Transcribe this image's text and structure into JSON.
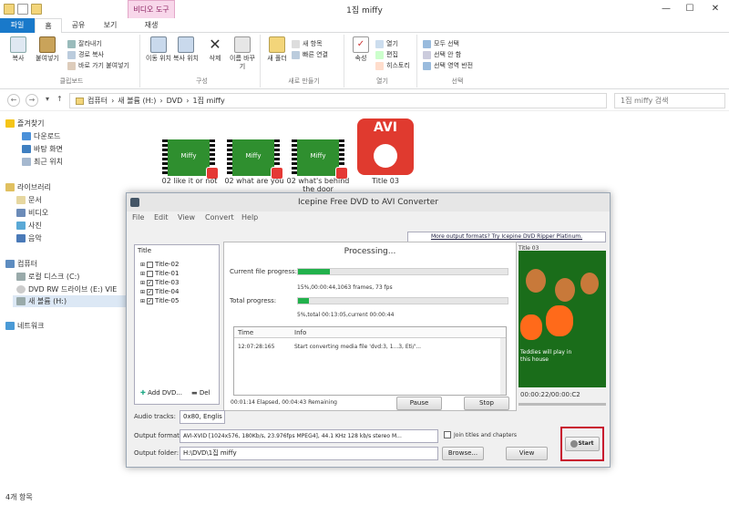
{
  "window": {
    "title": "1집 miffy",
    "context_tab": "비디오 도구",
    "controls": {
      "minimize": "—",
      "maximize": "☐",
      "close": "✕"
    }
  },
  "ribbon_tabs": [
    "파일",
    "홈",
    "공유",
    "보기",
    "재생"
  ],
  "ribbon": {
    "clipboard": {
      "items": [
        "복사",
        "붙여넣기"
      ],
      "small": [
        "잘라내기",
        "경로 복사",
        "바로 가기 붙여넣기"
      ],
      "label": "클립보드"
    },
    "organize": {
      "items": [
        "이동 위치",
        "복사 위치",
        "삭제",
        "이름 바꾸기"
      ],
      "label": "구성"
    },
    "new": {
      "items": [
        "새 폴더"
      ],
      "small": [
        "새 항목",
        "빠른 연결"
      ],
      "label": "새로 만들기"
    },
    "open": {
      "items": [
        "속성"
      ],
      "small": [
        "열기",
        "편집",
        "히스토리"
      ],
      "label": "열기"
    },
    "select": {
      "small": [
        "모두 선택",
        "선택 안 함",
        "선택 영역 반전"
      ],
      "label": "선택"
    }
  },
  "address": {
    "path": [
      "컴퓨터",
      "새 볼륨 (H:)",
      "DVD",
      "1집 miffy"
    ],
    "search_placeholder": "1집 miffy 검색"
  },
  "nav": {
    "favorites": "즐겨찾기",
    "fav_items": [
      "다운로드",
      "바탕 화면",
      "최근 위치"
    ],
    "libraries": "라이브러리",
    "lib_items": [
      "문서",
      "비디오",
      "사진",
      "음악"
    ],
    "computer": "컴퓨터",
    "comp_items": [
      "로컬 디스크 (C:)",
      "DVD RW 드라이브 (E:) VIE",
      "새 볼륨 (H:)"
    ],
    "network": "네트워크"
  },
  "files": [
    {
      "name": "02 like it or not",
      "thumb": "Miffy"
    },
    {
      "name": "02 what are you",
      "thumb": "Miffy"
    },
    {
      "name": "02 what's behind the door",
      "thumb": "Miffy"
    },
    {
      "name": "Title 03",
      "thumb": "AVI"
    }
  ],
  "status": "4개 항목",
  "dialog": {
    "title": "Icepine Free DVD to AVI Converter",
    "menu": [
      "File",
      "Edit",
      "View",
      "Convert",
      "Help"
    ],
    "promo_link": "More output formats? Try Icepine DVD Ripper Platinum.",
    "title_list_header": "Title",
    "titles": [
      {
        "name": "Title-02",
        "checked": false
      },
      {
        "name": "Title-01",
        "checked": false
      },
      {
        "name": "Title-03",
        "checked": true
      },
      {
        "name": "Title-04",
        "checked": true
      },
      {
        "name": "Title-05",
        "checked": true
      }
    ],
    "add_dvd": "Add DVD...",
    "del": "Del",
    "processing": "Processing...",
    "current_file_label": "Current file progress:",
    "current_file_pct": 15,
    "current_file_text": "15%,00:00:44,1063 frames, 73 fps",
    "total_label": "Total progress:",
    "total_pct": 5,
    "total_text": "5%,total 00:13:05,current 00:00:44",
    "log_headers": [
      "Time",
      "Info"
    ],
    "log_rows": [
      {
        "time": "12:07:28:165",
        "info": "Start converting media file 'dvd:3, 1...3, Eti/'..."
      }
    ],
    "elapsed": "00:01:14 Elapsed, 00:04:43 Remaining",
    "pause": "Pause",
    "stop": "Stop",
    "preview_title": "Title 03",
    "preview_subtitle": "Teddies will play in this house",
    "preview_time": "00:00:22/00:00:C2",
    "audio_label": "Audio tracks:",
    "audio_value": "0x80, Englis",
    "output_format_label": "Output format:",
    "output_format_value": "AVI-XVID [1024x576, 180Kb/s, 23.976fps MPEG4], 44.1 KHz 128 kb/s stereo M...",
    "join_label": "Join titles and chapters",
    "output_folder_label": "Output folder:",
    "output_folder_value": "H:\\DVD\\1집 miffy",
    "browse": "Browse...",
    "view": "View",
    "start": "Start"
  },
  "colors": {
    "accent": "#1979ca",
    "highlight": "#c8102e",
    "progress": "#22b14c"
  }
}
